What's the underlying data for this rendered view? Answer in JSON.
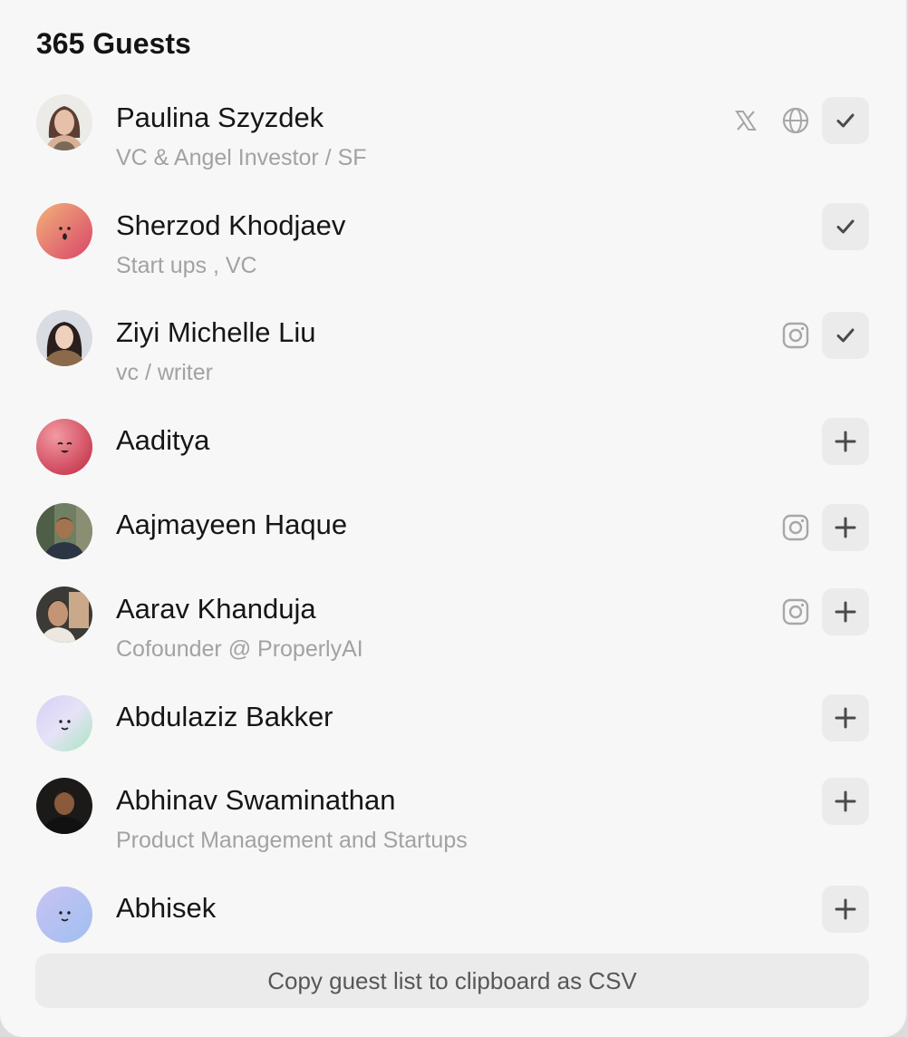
{
  "header": {
    "title": "365 Guests"
  },
  "guests": [
    {
      "name": "Paulina Szyzdek",
      "subtitle": "VC & Angel Investor / SF",
      "socials": [
        "x-icon",
        "globe-icon"
      ],
      "status": "added",
      "avatar": "photo-woman-light-hair"
    },
    {
      "name": "Sherzod Khodjaev",
      "subtitle": "Start ups , VC",
      "socials": [],
      "status": "added",
      "avatar": "gradient-face-orange"
    },
    {
      "name": "Ziyi Michelle Liu",
      "subtitle": "vc / writer",
      "socials": [
        "instagram-icon"
      ],
      "status": "added",
      "avatar": "photo-woman-dark-hair"
    },
    {
      "name": "Aaditya",
      "subtitle": "",
      "socials": [],
      "status": "not-added",
      "avatar": "gradient-face-red"
    },
    {
      "name": "Aajmayeen Haque",
      "subtitle": "",
      "socials": [
        "instagram-icon"
      ],
      "status": "not-added",
      "avatar": "photo-man-outdoor"
    },
    {
      "name": "Aarav Khanduja",
      "subtitle": "Cofounder @ ProperlyAI",
      "socials": [
        "instagram-icon"
      ],
      "status": "not-added",
      "avatar": "photo-man-selfie"
    },
    {
      "name": "Abdulaziz Bakker",
      "subtitle": "",
      "socials": [],
      "status": "not-added",
      "avatar": "gradient-face-lavender-green"
    },
    {
      "name": "Abhinav Swaminathan",
      "subtitle": "Product Management and Startups",
      "socials": [],
      "status": "not-added",
      "avatar": "photo-man-dark"
    },
    {
      "name": "Abhisek",
      "subtitle": "",
      "socials": [],
      "status": "not-added",
      "avatar": "gradient-face-blue"
    }
  ],
  "footer": {
    "copy_csv_label": "Copy guest list to clipboard as CSV"
  },
  "colors": {
    "modal_bg": "#f7f7f7",
    "button_bg": "#ebebeb",
    "subtitle_text": "#a2a2a2"
  }
}
